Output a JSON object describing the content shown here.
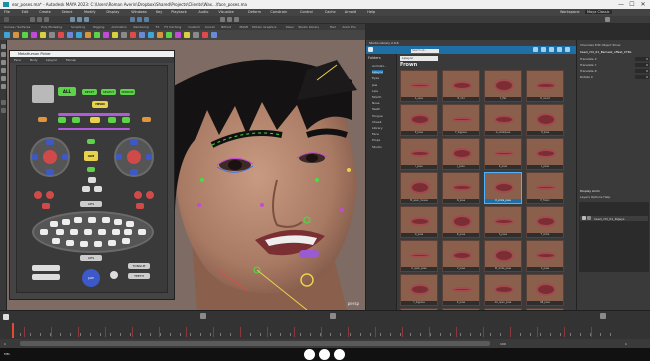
{
  "window": {
    "title": "ear_poses.ma* - Autodesk MAYA 2023: C:\\Users\\Roman Averin\\Dropbox\\Shared\\Projects\\Clients\\Wax...\\face_poses.ma",
    "minimize_glyph": "—",
    "maximize_glyph": "☐",
    "close_glyph": "✕"
  },
  "menubar": {
    "items": [
      "File",
      "Edit",
      "Create",
      "Select",
      "Modify",
      "Display",
      "Windows",
      "Key",
      "Playback",
      "Audio",
      "Visualize",
      "Deform",
      "Constrain",
      "Control",
      "Cache",
      "Arnold",
      "Help"
    ],
    "workspace_label": "Workspace:",
    "workspace_value": "Maya Classic"
  },
  "shelf": {
    "tabs": [
      "Curves / Surfaces",
      "Poly Modeling",
      "Sculpting",
      "Rigging",
      "Animation",
      "Rendering",
      "FX",
      "FX Caching",
      "Custom",
      "Arnold",
      "Bifrost",
      "MASH",
      "Motion Graphics",
      "XGen",
      "Studio Library",
      "Hair",
      "Anim Pro"
    ]
  },
  "picker": {
    "title": "MetaHuman Picker",
    "tabs": [
      "Face",
      "Body",
      "Lipsync",
      "Mocap"
    ],
    "buttons": {
      "all": "ALL",
      "head": "HEAD",
      "reset": "RESET",
      "select": "SELECT",
      "mirror": "MIRROR",
      "aim": "AIM",
      "tongue": "TONGUE",
      "teeth": "TEETH",
      "jaw": "JAW",
      "lips_up": "LIPS",
      "lips_low": "LIPS"
    },
    "colors": {
      "all": "#5dd34a",
      "yellow": "#e8d24c",
      "blue": "#3d59c8",
      "red": "#d14a4a",
      "purple": "#b05cd8",
      "orange": "#e2953a"
    }
  },
  "browser": {
    "title": "Studio Library 2.9.6",
    "breadcrumb": "Lipsync",
    "search_placeholder": "Search all...",
    "folders_label": "Folders",
    "folders": [
      "Animati...",
      "Lipsync",
      "Eyes",
      "Jaw",
      "Lips",
      "Mouth",
      "Nose",
      "Teeth",
      "Tongue",
      "Cheek",
      "Library",
      "Face",
      "Props",
      "Studio"
    ],
    "selected_folder": "Lipsync",
    "group_title": "Frown",
    "thumbnails": [
      "A_open",
      "B_mid",
      "C_flat",
      "D_round",
      "E_pose",
      "F_bigpose",
      "G_smallpose",
      "H_pose",
      "I_pose",
      "J_pose",
      "K_pose",
      "L_pose",
      "M_open_mouse",
      "N_pose",
      "O_smile_pose",
      "P_frown",
      "Q_pose",
      "R_pose",
      "S_pose",
      "T_smile",
      "U_open_pose",
      "V_pose",
      "W_smile_pose",
      "X_pose",
      "Y_bigpose",
      "Z_pose",
      "AA_open_pose",
      "AB_pose",
      "AC_pose",
      "AD_mid_pose",
      "AE_pose",
      "AF_pose"
    ],
    "selected_thumbnail": "O_smile_pose",
    "accent": "#1e6fa6"
  },
  "channelbox": {
    "header": "Channels  Edit  Object  Show",
    "node": "head_ctrl_01_Bsmask_offset_CTRL",
    "channels": [
      {
        "name": "Translate X",
        "value": "0"
      },
      {
        "name": "Translate Y",
        "value": "0"
      },
      {
        "name": "Translate Z",
        "value": "0"
      },
      {
        "name": "Rotate X",
        "value": "0"
      }
    ],
    "layers_header": "Display  Anim",
    "layers_menu": "Layers  Options  Help",
    "layer_name": "head_ctrl_01_Rigsys"
  },
  "viewport": {
    "camera_label": "persp",
    "axis_label": "y"
  },
  "timeline": {
    "start": "1",
    "end": "100",
    "current": "1"
  },
  "commandline": {
    "mode": "MEL"
  }
}
